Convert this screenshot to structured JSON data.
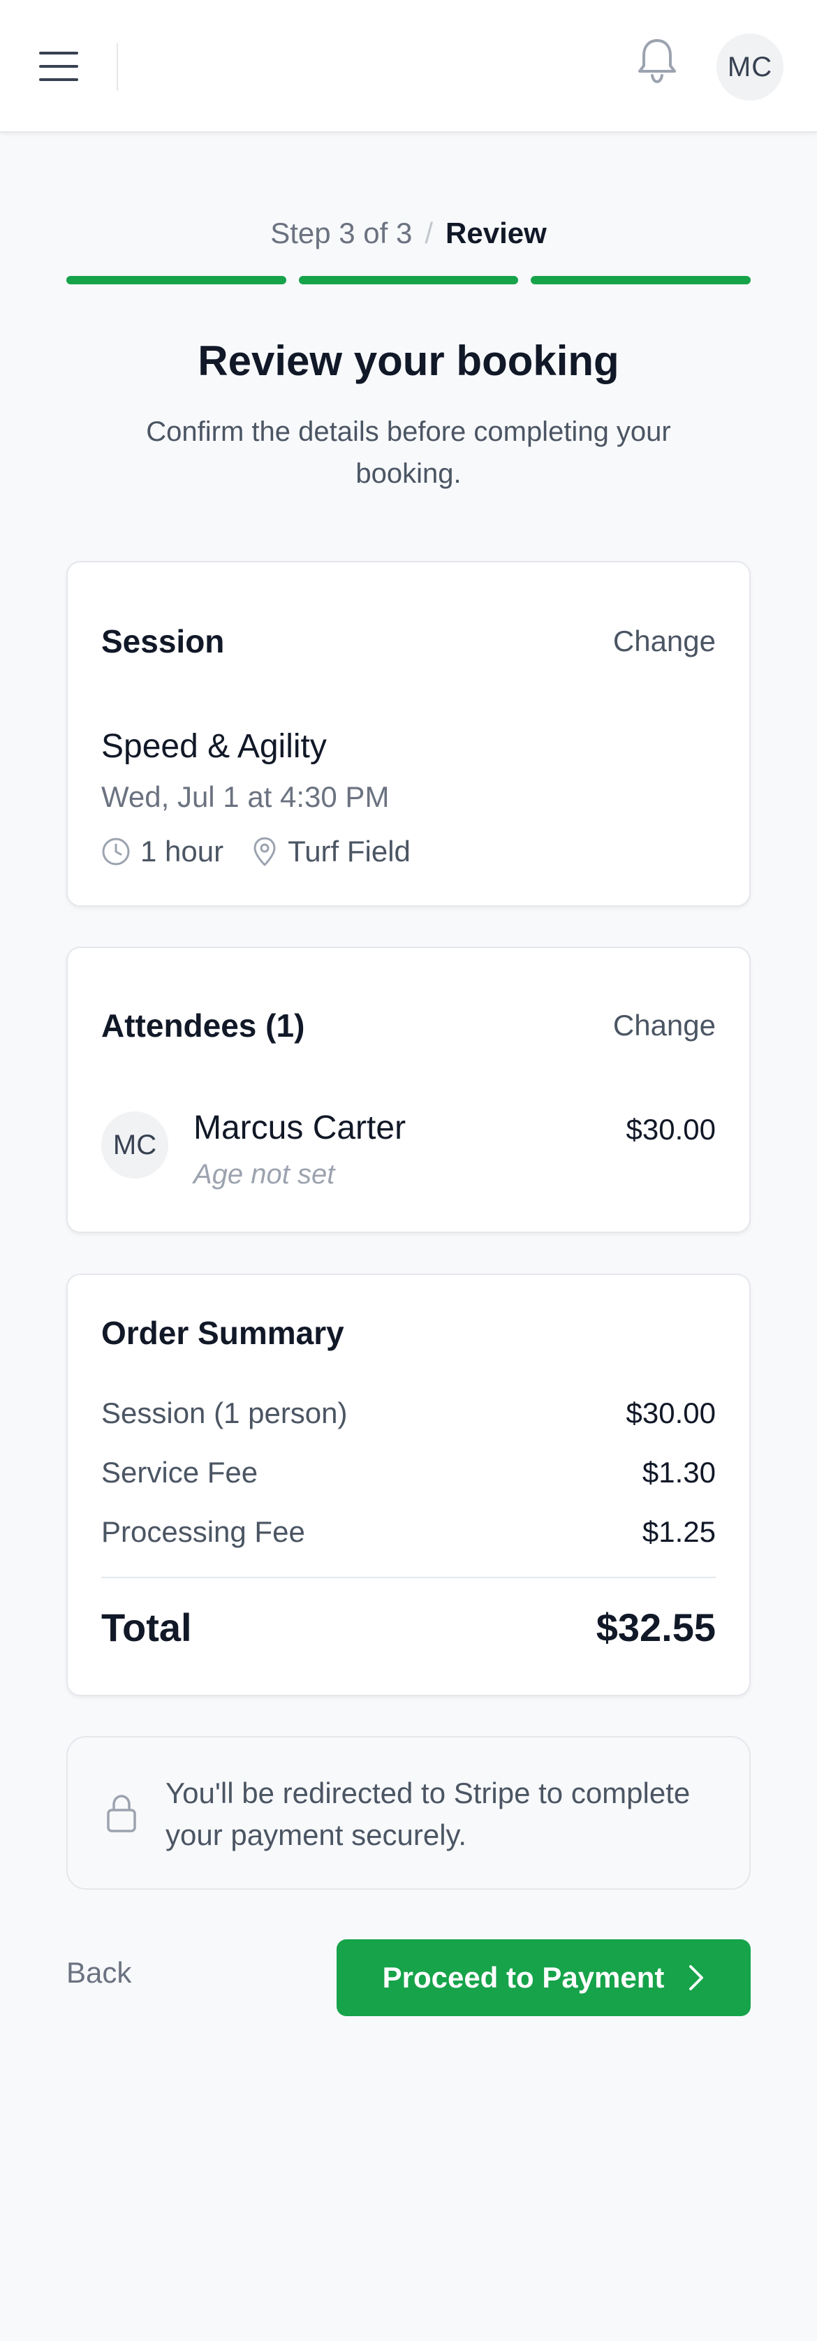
{
  "header": {
    "menu_icon": "hamburger-menu-icon",
    "notification_icon": "bell-icon",
    "user_initials": "MC"
  },
  "stepper": {
    "count": "Step 3 of 3",
    "separator": "/",
    "current": "Review",
    "total_steps": 3,
    "completed_steps": 3,
    "accent_color": "#16a34a"
  },
  "page": {
    "title": "Review your booking",
    "subtitle": "Confirm the details before completing your booking."
  },
  "session_card": {
    "title": "Session",
    "change_label": "Change",
    "name": "Speed & Agility",
    "datetime": "Wed, Jul 1 at 4:30 PM",
    "duration": "1 hour",
    "location": "Turf Field"
  },
  "attendees_card": {
    "title": "Attendees (1)",
    "change_label": "Change",
    "attendees": [
      {
        "initials": "MC",
        "name": "Marcus Carter",
        "age": "Age not set",
        "price": "$30.00"
      }
    ]
  },
  "order_summary": {
    "title": "Order Summary",
    "lines": [
      {
        "label": "Session (1 person)",
        "value": "$30.00"
      },
      {
        "label": "Service Fee",
        "value": "$1.30"
      },
      {
        "label": "Processing Fee",
        "value": "$1.25"
      }
    ],
    "total_label": "Total",
    "total_value": "$32.55"
  },
  "notice": {
    "icon": "lock-icon",
    "text": "You'll be redirected to Stripe to complete your payment securely."
  },
  "actions": {
    "back_label": "Back",
    "proceed_label": "Proceed to Payment",
    "proceed_color": "#16a34a"
  }
}
